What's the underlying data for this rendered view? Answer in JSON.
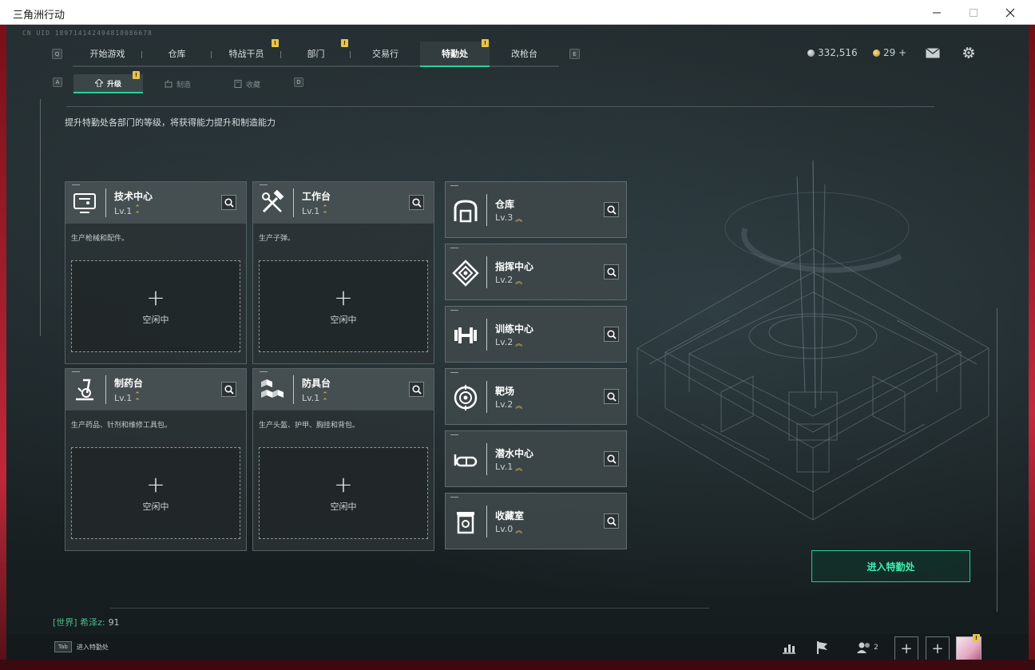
{
  "window": {
    "title": "三角洲行动"
  },
  "uid": "CN UID 189714142494810086678",
  "nav": {
    "left_key": "Q",
    "right_key": "E",
    "tabs": [
      {
        "label": "开始游戏",
        "badge": ""
      },
      {
        "label": "仓库",
        "badge": ""
      },
      {
        "label": "特战干员",
        "badge": "!"
      },
      {
        "label": "部门",
        "badge": "!"
      },
      {
        "label": "交易行",
        "badge": ""
      },
      {
        "label": "特勤处",
        "badge": "!",
        "active": true
      },
      {
        "label": "改枪台",
        "badge": ""
      }
    ]
  },
  "currency": {
    "hafu_coin": "332,516",
    "tickets": "29 +"
  },
  "subtabs": {
    "left_key": "A",
    "right_key": "D",
    "items": [
      {
        "label": "升级",
        "icon": "upgrade-icon",
        "badge": "!",
        "active": true
      },
      {
        "label": "制造",
        "icon": "craft-icon"
      },
      {
        "label": "收藏",
        "icon": "collection-icon"
      }
    ]
  },
  "description": "提升特勤处各部门的等级，将获得能力提升和制造能力",
  "production": [
    {
      "name": "技术中心",
      "level": "Lv.1",
      "desc": "生产枪械和配件。",
      "slot_status": "空闲中",
      "icon": "tech-center-icon"
    },
    {
      "name": "工作台",
      "level": "Lv.1",
      "desc": "生产子弹。",
      "slot_status": "空闲中",
      "icon": "workbench-icon"
    },
    {
      "name": "制药台",
      "level": "Lv.1",
      "desc": "生产药品、针剂和维修工具包。",
      "slot_status": "空闲中",
      "icon": "pharmacy-icon"
    },
    {
      "name": "防具台",
      "level": "Lv.1",
      "desc": "生产头盔、护甲、胸挂和背包。",
      "slot_status": "空闲中",
      "icon": "armor-bench-icon"
    }
  ],
  "facilities": [
    {
      "name": "仓库",
      "level": "Lv.3",
      "icon": "warehouse-icon"
    },
    {
      "name": "指挥中心",
      "level": "Lv.2",
      "icon": "command-center-icon"
    },
    {
      "name": "训练中心",
      "level": "Lv.2",
      "icon": "dumbbell-icon"
    },
    {
      "name": "靶场",
      "level": "Lv.2",
      "icon": "target-icon"
    },
    {
      "name": "潜水中心",
      "level": "Lv.1",
      "icon": "diving-mask-icon"
    },
    {
      "name": "收藏室",
      "level": "Lv.0",
      "icon": "collection-room-icon"
    }
  ],
  "enter_button": "进入特勤处",
  "chat": {
    "channel": "[世界] 希泽z:",
    "message": "91"
  },
  "bottom": {
    "tab_key": "Tab",
    "tab_label": "进入特勤处",
    "squad_count": "2",
    "avatar_badge": "!"
  },
  "colors": {
    "accent": "#25d39a",
    "badge": "#e9c44a",
    "panel": "#2a3234"
  }
}
